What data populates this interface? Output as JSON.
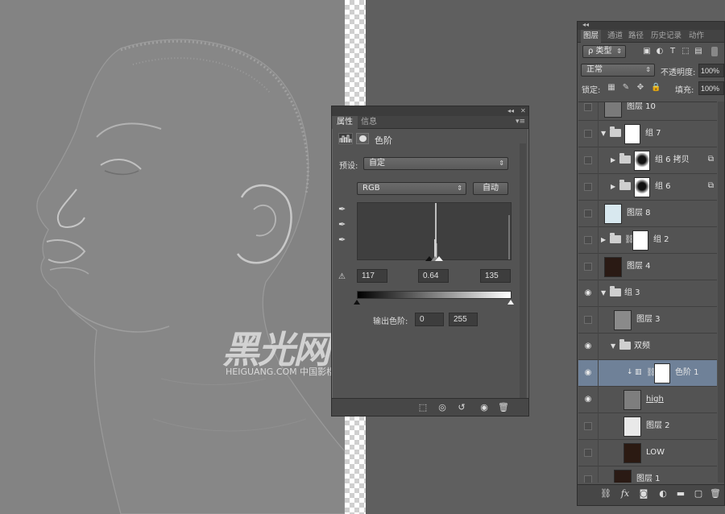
{
  "watermark": {
    "logo_text": "黑光网",
    "caption": "HEIGUANG.COM 中国影楼权威门户"
  },
  "properties_panel": {
    "collapse_glyph": "◂◂",
    "close_glyph": "✕",
    "tabs": [
      {
        "label": "属性",
        "active": true
      },
      {
        "label": "信息",
        "active": false
      }
    ],
    "menu_glyph": "▾≡",
    "adjustment_icon": "levels-icon",
    "mask_icon": "mask-icon",
    "title": "色阶",
    "preset_label": "预设:",
    "preset_value": "自定",
    "channel_value": "RGB",
    "auto_button": "自动",
    "input_black": "117",
    "input_gamma": "0.64",
    "input_white": "135",
    "output_label": "输出色阶:",
    "output_black": "0",
    "output_white": "255",
    "warning_glyph": "⚠"
  },
  "layers_panel": {
    "tabs": [
      {
        "label": "图层",
        "active": true
      },
      {
        "label": "通道",
        "active": false
      },
      {
        "label": "路径",
        "active": false
      },
      {
        "label": "历史记录",
        "active": false
      },
      {
        "label": "动作",
        "active": false
      }
    ],
    "filter_label": "ρ 类型",
    "blend_mode": "正常",
    "opacity_label": "不透明度:",
    "opacity_value": "100%",
    "lock_label": "锁定:",
    "fill_label": "填充:",
    "fill_value": "100%",
    "footer_icons": [
      "link-icon",
      "fx-icon",
      "mask-add-icon",
      "adjustment-add-icon",
      "group-add-icon",
      "new-layer-icon",
      "trash-icon"
    ],
    "layers": [
      {
        "name": "图层 10",
        "visible": false,
        "kind": "layer",
        "indent": 0
      },
      {
        "name": "组 7",
        "visible": false,
        "kind": "group-open",
        "indent": 0
      },
      {
        "name": "组 6 拷贝",
        "visible": false,
        "kind": "group-closed-mask",
        "indent": 1
      },
      {
        "name": "组 6",
        "visible": false,
        "kind": "group-closed-mask",
        "indent": 1
      },
      {
        "name": "图层 8",
        "visible": false,
        "kind": "layer",
        "indent": 0
      },
      {
        "name": "组 2",
        "visible": false,
        "kind": "group-closed-linkmask",
        "indent": 0
      },
      {
        "name": "图层 4",
        "visible": false,
        "kind": "layer",
        "indent": 0
      },
      {
        "name": "组 3",
        "visible": true,
        "kind": "group-open-nothumb",
        "indent": 0
      },
      {
        "name": "图层 3",
        "visible": false,
        "kind": "layer",
        "indent": 1
      },
      {
        "name": "双频",
        "visible": true,
        "kind": "group-open-nothumb",
        "indent": 1
      },
      {
        "name": "色阶 1",
        "visible": true,
        "kind": "adjustment",
        "indent": 2,
        "selected": true
      },
      {
        "name": "high",
        "visible": true,
        "kind": "layer",
        "indent": 2
      },
      {
        "name": "图层 2",
        "visible": false,
        "kind": "layer",
        "indent": 2
      },
      {
        "name": "LOW",
        "visible": false,
        "kind": "layer",
        "indent": 2
      },
      {
        "name": "图层 1",
        "visible": false,
        "kind": "layer",
        "indent": 1
      }
    ]
  }
}
